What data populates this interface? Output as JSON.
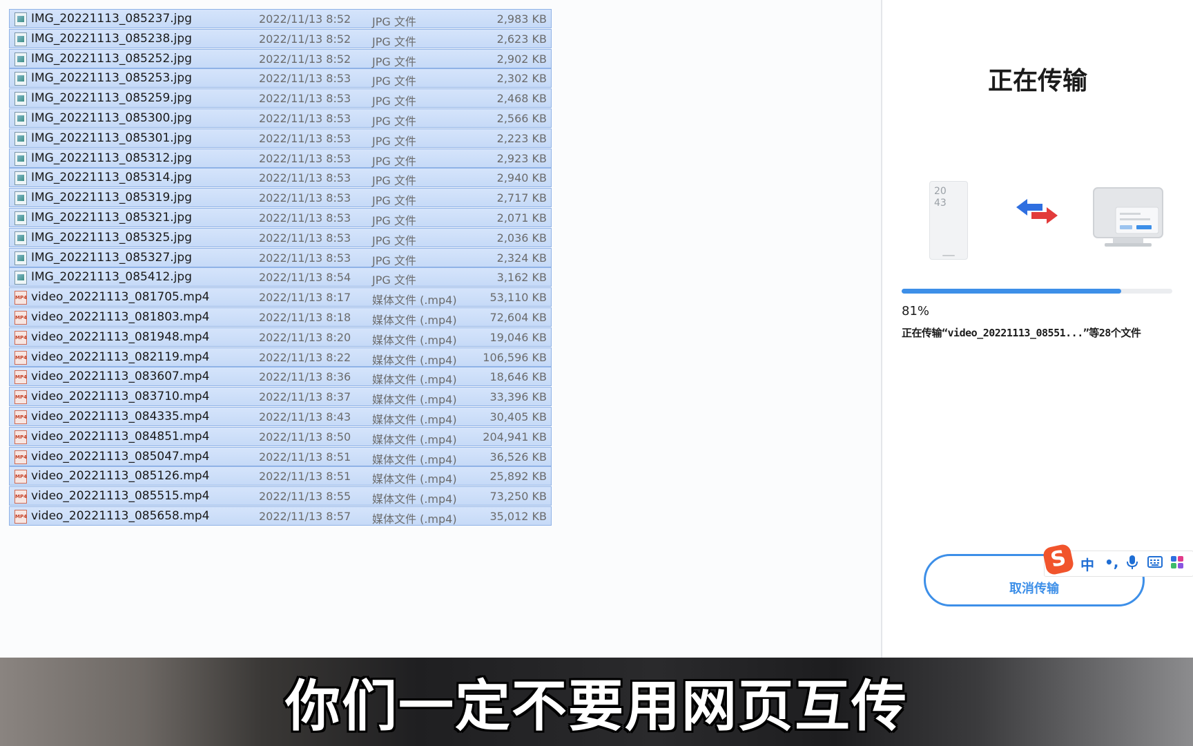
{
  "file_list": {
    "rows": [
      {
        "kind": "jpg",
        "name": "IMG_20221113_085237.jpg",
        "date": "2022/11/13 8:52",
        "type": "JPG 文件",
        "size": "2,983 KB"
      },
      {
        "kind": "jpg",
        "name": "IMG_20221113_085238.jpg",
        "date": "2022/11/13 8:52",
        "type": "JPG 文件",
        "size": "2,623 KB"
      },
      {
        "kind": "jpg",
        "name": "IMG_20221113_085252.jpg",
        "date": "2022/11/13 8:52",
        "type": "JPG 文件",
        "size": "2,902 KB"
      },
      {
        "kind": "jpg",
        "name": "IMG_20221113_085253.jpg",
        "date": "2022/11/13 8:53",
        "type": "JPG 文件",
        "size": "2,302 KB"
      },
      {
        "kind": "jpg",
        "name": "IMG_20221113_085259.jpg",
        "date": "2022/11/13 8:53",
        "type": "JPG 文件",
        "size": "2,468 KB"
      },
      {
        "kind": "jpg",
        "name": "IMG_20221113_085300.jpg",
        "date": "2022/11/13 8:53",
        "type": "JPG 文件",
        "size": "2,566 KB"
      },
      {
        "kind": "jpg",
        "name": "IMG_20221113_085301.jpg",
        "date": "2022/11/13 8:53",
        "type": "JPG 文件",
        "size": "2,223 KB"
      },
      {
        "kind": "jpg",
        "name": "IMG_20221113_085312.jpg",
        "date": "2022/11/13 8:53",
        "type": "JPG 文件",
        "size": "2,923 KB"
      },
      {
        "kind": "jpg",
        "name": "IMG_20221113_085314.jpg",
        "date": "2022/11/13 8:53",
        "type": "JPG 文件",
        "size": "2,940 KB"
      },
      {
        "kind": "jpg",
        "name": "IMG_20221113_085319.jpg",
        "date": "2022/11/13 8:53",
        "type": "JPG 文件",
        "size": "2,717 KB"
      },
      {
        "kind": "jpg",
        "name": "IMG_20221113_085321.jpg",
        "date": "2022/11/13 8:53",
        "type": "JPG 文件",
        "size": "2,071 KB"
      },
      {
        "kind": "jpg",
        "name": "IMG_20221113_085325.jpg",
        "date": "2022/11/13 8:53",
        "type": "JPG 文件",
        "size": "2,036 KB"
      },
      {
        "kind": "jpg",
        "name": "IMG_20221113_085327.jpg",
        "date": "2022/11/13 8:53",
        "type": "JPG 文件",
        "size": "2,324 KB"
      },
      {
        "kind": "jpg",
        "name": "IMG_20221113_085412.jpg",
        "date": "2022/11/13 8:54",
        "type": "JPG 文件",
        "size": "3,162 KB"
      },
      {
        "kind": "mp4",
        "name": "video_20221113_081705.mp4",
        "date": "2022/11/13 8:17",
        "type": "媒体文件 (.mp4)",
        "size": "53,110 KB"
      },
      {
        "kind": "mp4",
        "name": "video_20221113_081803.mp4",
        "date": "2022/11/13 8:18",
        "type": "媒体文件 (.mp4)",
        "size": "72,604 KB"
      },
      {
        "kind": "mp4",
        "name": "video_20221113_081948.mp4",
        "date": "2022/11/13 8:20",
        "type": "媒体文件 (.mp4)",
        "size": "19,046 KB"
      },
      {
        "kind": "mp4",
        "name": "video_20221113_082119.mp4",
        "date": "2022/11/13 8:22",
        "type": "媒体文件 (.mp4)",
        "size": "106,596 KB"
      },
      {
        "kind": "mp4",
        "name": "video_20221113_083607.mp4",
        "date": "2022/11/13 8:36",
        "type": "媒体文件 (.mp4)",
        "size": "18,646 KB"
      },
      {
        "kind": "mp4",
        "name": "video_20221113_083710.mp4",
        "date": "2022/11/13 8:37",
        "type": "媒体文件 (.mp4)",
        "size": "33,396 KB"
      },
      {
        "kind": "mp4",
        "name": "video_20221113_084335.mp4",
        "date": "2022/11/13 8:43",
        "type": "媒体文件 (.mp4)",
        "size": "30,405 KB"
      },
      {
        "kind": "mp4",
        "name": "video_20221113_084851.mp4",
        "date": "2022/11/13 8:50",
        "type": "媒体文件 (.mp4)",
        "size": "204,941 KB"
      },
      {
        "kind": "mp4",
        "name": "video_20221113_085047.mp4",
        "date": "2022/11/13 8:51",
        "type": "媒体文件 (.mp4)",
        "size": "36,526 KB"
      },
      {
        "kind": "mp4",
        "name": "video_20221113_085126.mp4",
        "date": "2022/11/13 8:51",
        "type": "媒体文件 (.mp4)",
        "size": "25,892 KB"
      },
      {
        "kind": "mp4",
        "name": "video_20221113_085515.mp4",
        "date": "2022/11/13 8:55",
        "type": "媒体文件 (.mp4)",
        "size": "73,250 KB"
      },
      {
        "kind": "mp4",
        "name": "video_20221113_085658.mp4",
        "date": "2022/11/13 8:57",
        "type": "媒体文件 (.mp4)",
        "size": "35,012 KB"
      }
    ]
  },
  "transfer": {
    "title": "正在传输",
    "phone_time": "20\n43",
    "progress": 0.81,
    "percent_label": "81%",
    "status": "正在传输“video_20221113_08551...”等28个文件",
    "cancel_label": "取消传输",
    "accent_color": "#3d8fe8"
  },
  "ime": {
    "logo": "S",
    "lang": "中",
    "punct": "•,",
    "voice_icon": "microphone-icon",
    "keyboard_icon": "keyboard-icon",
    "apps_icon": "grid-apps-icon"
  },
  "caption": {
    "text": "你们一定不要用网页互传"
  }
}
